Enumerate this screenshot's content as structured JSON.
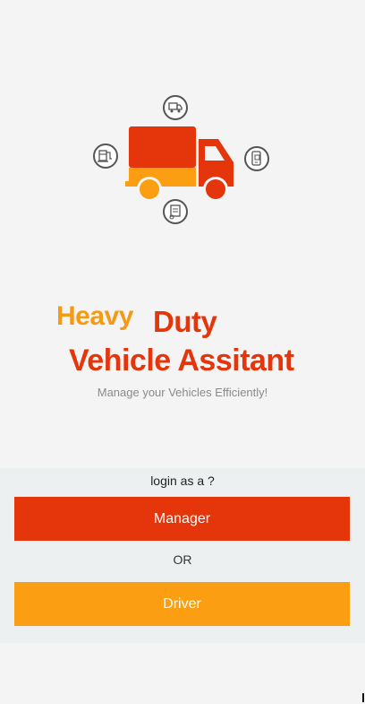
{
  "app": {
    "title_heavy": "Heavy",
    "title_duty": "Duty",
    "title_line2": "Vehicle Assitant",
    "tagline": "Manage your Vehicles Efficiently!"
  },
  "login": {
    "prompt": "login as a ?",
    "manager_label": "Manager",
    "or_label": "OR",
    "driver_label": "Driver"
  },
  "icons": {
    "main": "truck-icon",
    "top": "delivery-truck-icon",
    "left": "fuel-pump-icon",
    "right": "mobile-phone-icon",
    "bottom": "clipboard-location-icon"
  },
  "colors": {
    "brand_red": "#e4350b",
    "brand_orange": "#fb9e12",
    "tagline_gray": "#8a8a8a",
    "background": "#f4f4f4",
    "panel": "#edf0f0"
  }
}
